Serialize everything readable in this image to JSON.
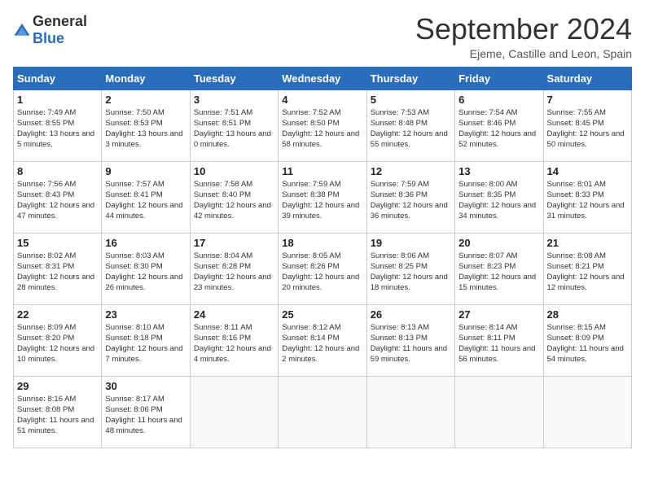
{
  "header": {
    "logo_general": "General",
    "logo_blue": "Blue",
    "month_title": "September 2024",
    "location": "Ejeme, Castille and Leon, Spain"
  },
  "days_of_week": [
    "Sunday",
    "Monday",
    "Tuesday",
    "Wednesday",
    "Thursday",
    "Friday",
    "Saturday"
  ],
  "weeks": [
    [
      {
        "day": "1",
        "sunrise": "7:49 AM",
        "sunset": "8:55 PM",
        "daylight": "13 hours and 5 minutes."
      },
      {
        "day": "2",
        "sunrise": "7:50 AM",
        "sunset": "8:53 PM",
        "daylight": "13 hours and 3 minutes."
      },
      {
        "day": "3",
        "sunrise": "7:51 AM",
        "sunset": "8:51 PM",
        "daylight": "13 hours and 0 minutes."
      },
      {
        "day": "4",
        "sunrise": "7:52 AM",
        "sunset": "8:50 PM",
        "daylight": "12 hours and 58 minutes."
      },
      {
        "day": "5",
        "sunrise": "7:53 AM",
        "sunset": "8:48 PM",
        "daylight": "12 hours and 55 minutes."
      },
      {
        "day": "6",
        "sunrise": "7:54 AM",
        "sunset": "8:46 PM",
        "daylight": "12 hours and 52 minutes."
      },
      {
        "day": "7",
        "sunrise": "7:55 AM",
        "sunset": "8:45 PM",
        "daylight": "12 hours and 50 minutes."
      }
    ],
    [
      {
        "day": "8",
        "sunrise": "7:56 AM",
        "sunset": "8:43 PM",
        "daylight": "12 hours and 47 minutes."
      },
      {
        "day": "9",
        "sunrise": "7:57 AM",
        "sunset": "8:41 PM",
        "daylight": "12 hours and 44 minutes."
      },
      {
        "day": "10",
        "sunrise": "7:58 AM",
        "sunset": "8:40 PM",
        "daylight": "12 hours and 42 minutes."
      },
      {
        "day": "11",
        "sunrise": "7:59 AM",
        "sunset": "8:38 PM",
        "daylight": "12 hours and 39 minutes."
      },
      {
        "day": "12",
        "sunrise": "7:59 AM",
        "sunset": "8:36 PM",
        "daylight": "12 hours and 36 minutes."
      },
      {
        "day": "13",
        "sunrise": "8:00 AM",
        "sunset": "8:35 PM",
        "daylight": "12 hours and 34 minutes."
      },
      {
        "day": "14",
        "sunrise": "8:01 AM",
        "sunset": "8:33 PM",
        "daylight": "12 hours and 31 minutes."
      }
    ],
    [
      {
        "day": "15",
        "sunrise": "8:02 AM",
        "sunset": "8:31 PM",
        "daylight": "12 hours and 28 minutes."
      },
      {
        "day": "16",
        "sunrise": "8:03 AM",
        "sunset": "8:30 PM",
        "daylight": "12 hours and 26 minutes."
      },
      {
        "day": "17",
        "sunrise": "8:04 AM",
        "sunset": "8:28 PM",
        "daylight": "12 hours and 23 minutes."
      },
      {
        "day": "18",
        "sunrise": "8:05 AM",
        "sunset": "8:26 PM",
        "daylight": "12 hours and 20 minutes."
      },
      {
        "day": "19",
        "sunrise": "8:06 AM",
        "sunset": "8:25 PM",
        "daylight": "12 hours and 18 minutes."
      },
      {
        "day": "20",
        "sunrise": "8:07 AM",
        "sunset": "8:23 PM",
        "daylight": "12 hours and 15 minutes."
      },
      {
        "day": "21",
        "sunrise": "8:08 AM",
        "sunset": "8:21 PM",
        "daylight": "12 hours and 12 minutes."
      }
    ],
    [
      {
        "day": "22",
        "sunrise": "8:09 AM",
        "sunset": "8:20 PM",
        "daylight": "12 hours and 10 minutes."
      },
      {
        "day": "23",
        "sunrise": "8:10 AM",
        "sunset": "8:18 PM",
        "daylight": "12 hours and 7 minutes."
      },
      {
        "day": "24",
        "sunrise": "8:11 AM",
        "sunset": "8:16 PM",
        "daylight": "12 hours and 4 minutes."
      },
      {
        "day": "25",
        "sunrise": "8:12 AM",
        "sunset": "8:14 PM",
        "daylight": "12 hours and 2 minutes."
      },
      {
        "day": "26",
        "sunrise": "8:13 AM",
        "sunset": "8:13 PM",
        "daylight": "11 hours and 59 minutes."
      },
      {
        "day": "27",
        "sunrise": "8:14 AM",
        "sunset": "8:11 PM",
        "daylight": "11 hours and 56 minutes."
      },
      {
        "day": "28",
        "sunrise": "8:15 AM",
        "sunset": "8:09 PM",
        "daylight": "11 hours and 54 minutes."
      }
    ],
    [
      {
        "day": "29",
        "sunrise": "8:16 AM",
        "sunset": "8:08 PM",
        "daylight": "11 hours and 51 minutes."
      },
      {
        "day": "30",
        "sunrise": "8:17 AM",
        "sunset": "8:06 PM",
        "daylight": "11 hours and 48 minutes."
      },
      null,
      null,
      null,
      null,
      null
    ]
  ]
}
